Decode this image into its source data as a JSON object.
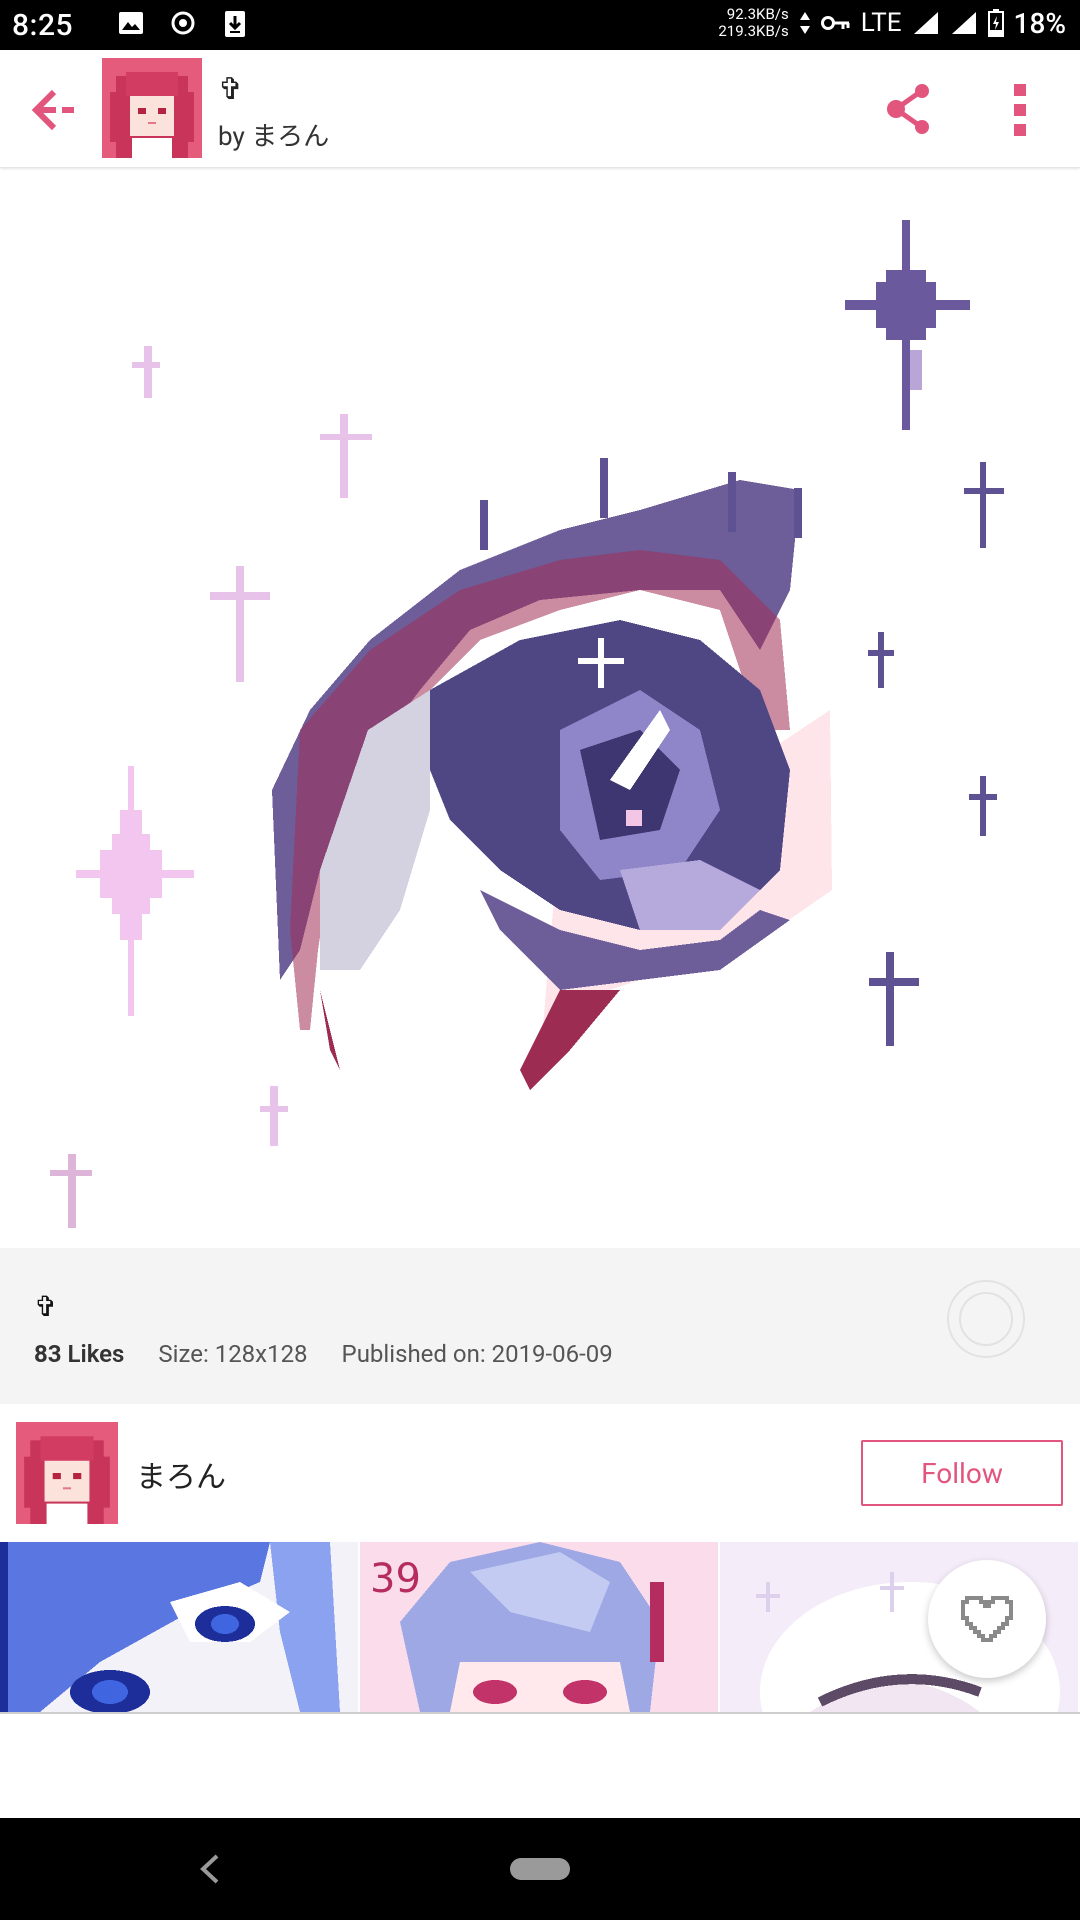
{
  "status_bar": {
    "time": "8:25",
    "net_up": "92.3KB/s",
    "net_down": "219.3KB/s",
    "network": "LTE",
    "battery": "18%"
  },
  "header": {
    "title": "✞",
    "author": "by まろん"
  },
  "artwork": {
    "title": "✞",
    "likes_count": "83",
    "likes_label": "Likes",
    "size": "Size: 128x128",
    "published": "Published on: 2019-06-09"
  },
  "author": {
    "name": "まろん",
    "follow_label": "Follow"
  },
  "colors": {
    "accent": "#e2557d",
    "purple": "#5e5293",
    "pink_light": "#f2c6ee"
  },
  "icons": [
    "back-arrow-icon",
    "share-icon",
    "more-vert-icon",
    "heart-outline-icon",
    "loading-ring-icon"
  ]
}
